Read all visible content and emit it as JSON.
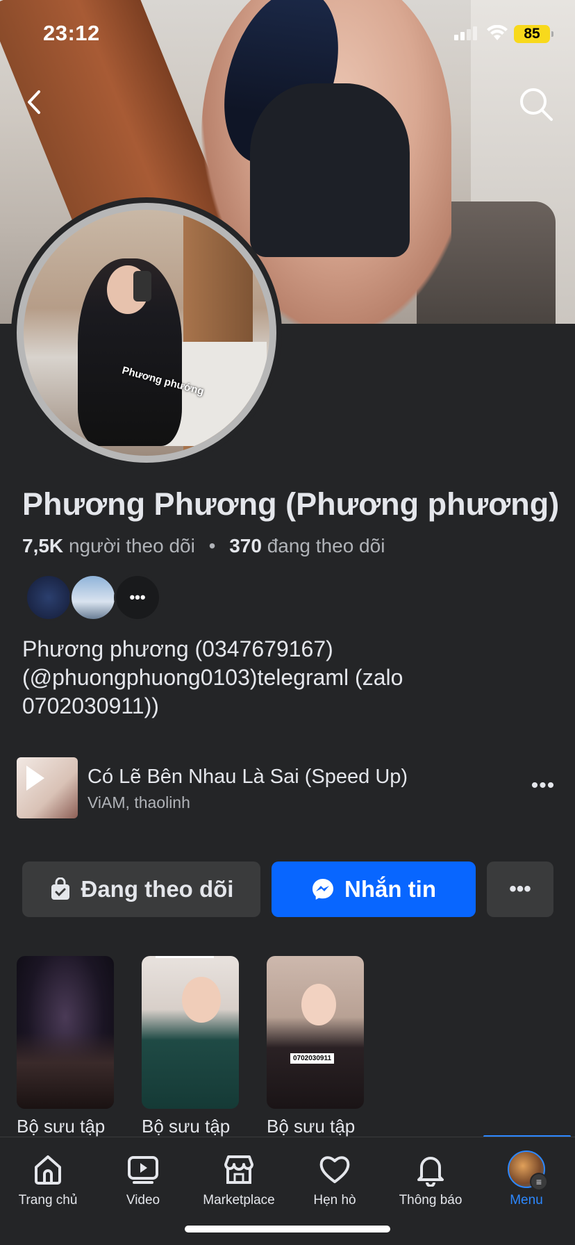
{
  "status_bar": {
    "time": "23:12",
    "battery": "85"
  },
  "profile": {
    "name": "Phương Phương (Phương phương)",
    "avatar_caption": "Phương phướng",
    "followers_count": "7,5K",
    "followers_label": "người theo dõi",
    "following_count": "370",
    "following_label": "đang theo dõi",
    "bio": "Phương phương (0347679167) (@phuongphuong0103)telegraml (zalo 0702030911))"
  },
  "music": {
    "title": "Có Lẽ Bên Nhau Là Sai (Speed Up)",
    "artist": "ViAM, thaolinh"
  },
  "actions": {
    "follow_label": "Đang theo dõi",
    "message_label": "Nhắn tin"
  },
  "collections": [
    {
      "label": "Bộ sưu tập"
    },
    {
      "label": "Bộ sưu tập"
    },
    {
      "label": "Bộ sưu tập",
      "tag": "0702030911"
    }
  ],
  "tabbar": {
    "items": [
      {
        "label": "Trang chủ",
        "icon": "home-icon"
      },
      {
        "label": "Video",
        "icon": "video-icon"
      },
      {
        "label": "Marketplace",
        "icon": "marketplace-icon"
      },
      {
        "label": "Hẹn hò",
        "icon": "heart-icon"
      },
      {
        "label": "Thông báo",
        "icon": "bell-icon"
      },
      {
        "label": "Menu",
        "icon": "menu-avatar",
        "active": true
      }
    ]
  },
  "colors": {
    "accent": "#0866ff",
    "active_tab": "#2d88ff",
    "background": "#242527"
  }
}
